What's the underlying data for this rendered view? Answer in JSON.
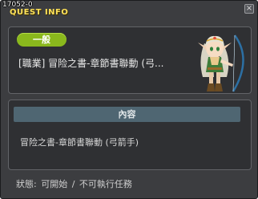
{
  "window": {
    "version": "17052-0",
    "title": "QUEST INFO",
    "close_glyph": "×"
  },
  "quest": {
    "category": "一般",
    "name": "[職業] 冒险之書-章節書聯動 (弓...",
    "npc_icon": "elf-archer-npc-icon"
  },
  "content": {
    "header": "內容",
    "text": "冒险之書-章節書聯動 (弓箭手)"
  },
  "status": {
    "text": "狀態: 可開始 / 不可執行任務"
  },
  "colors": {
    "window_bg": "#3c3d40",
    "panel_bg": "#2f3033",
    "title": "#ffe35a",
    "badge": "#8ab81d",
    "content_header": "#4f6672"
  }
}
